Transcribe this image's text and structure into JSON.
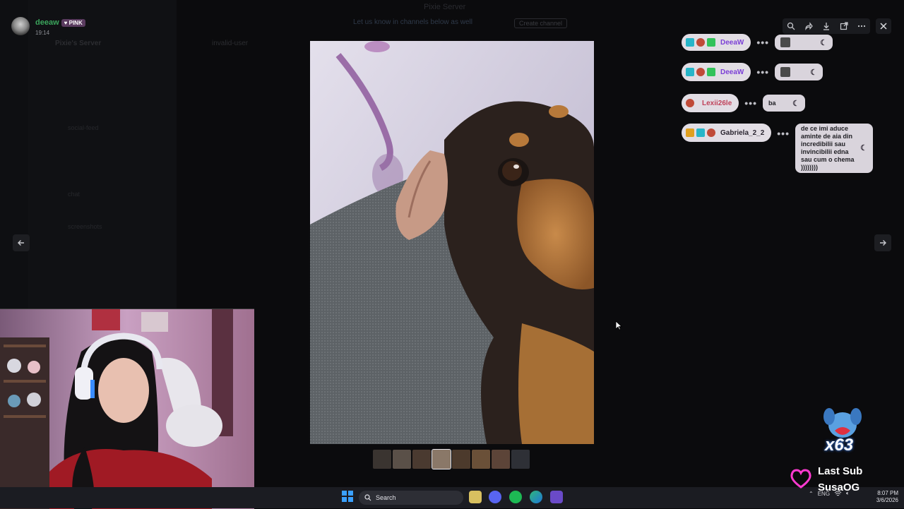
{
  "window": {
    "title": "Pixie Server"
  },
  "banner": {
    "text": "Let us know in channels below as well",
    "button": "Create channel"
  },
  "background": {
    "server_name": "Pixie's Server",
    "channel_name": "invalid-user",
    "categories": [
      "social-feed",
      "chat",
      "screenshots"
    ]
  },
  "viewer": {
    "uploader_name": "deeaw",
    "uploader_badge": "PINK",
    "upload_time": "19:14",
    "toolbar": [
      "zoom-icon",
      "forward-icon",
      "download-icon",
      "open-external-icon",
      "more-icon"
    ],
    "thumbnail_count": 8,
    "active_thumbnail": 3
  },
  "chat": [
    {
      "user": "DeeaW",
      "user_color": "#7b3fd6",
      "message": ""
    },
    {
      "user": "DeeaW",
      "user_color": "#7b3fd6",
      "message": ""
    },
    {
      "user": "Lexii26le",
      "user_color": "#c0425a",
      "message": "ba"
    },
    {
      "user": "Gabriela_2_2",
      "user_color": "#2a2530",
      "message": "de ce imi aduce aminte de aia din incredibilii sau invincibilii edna sau cum o chema ))))))))"
    }
  ],
  "overlay": {
    "sub_count": "x63",
    "last_sub_label": "Last Sub",
    "last_sub_name": "SusaOG"
  },
  "taskbar": {
    "search_placeholder": "Search",
    "language": "ENG",
    "time": "8:07 PM",
    "date": "3/6/2026"
  }
}
